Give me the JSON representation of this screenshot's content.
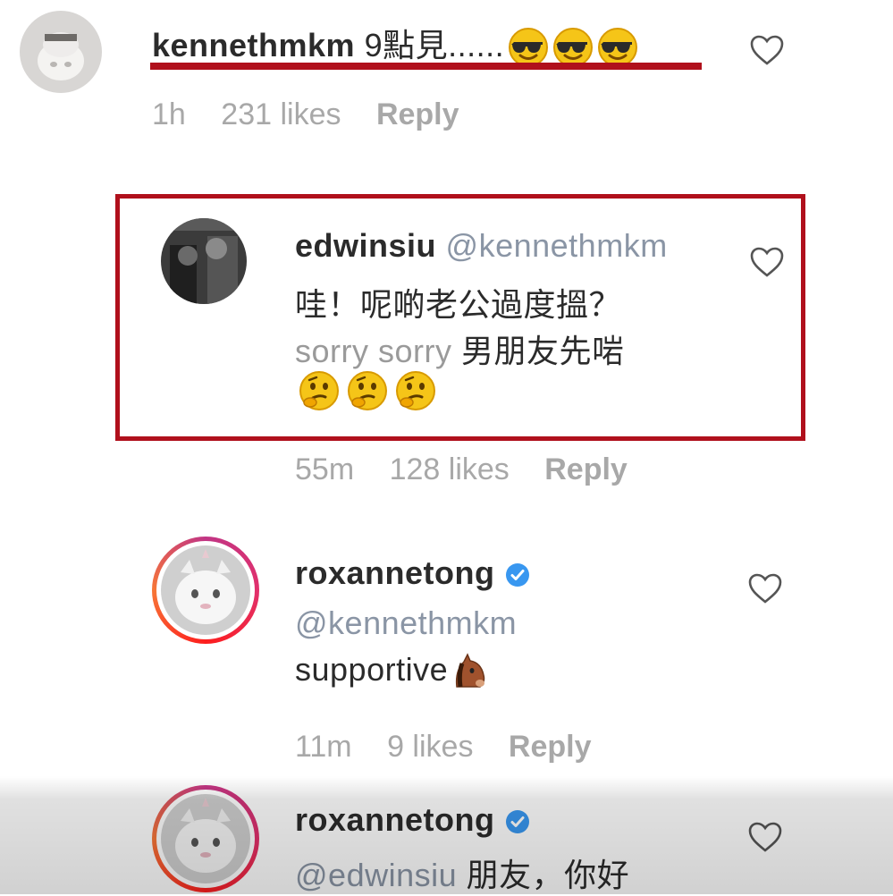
{
  "comments": [
    {
      "username": "kennethmkm",
      "text": "9點見......",
      "emoji_icon": "smiling-face-with-sunglasses",
      "emoji_count": 3,
      "time": "1h",
      "likes": "231 likes",
      "reply": "Reply"
    },
    {
      "username": "edwinsiu",
      "mention": "@kennethmkm",
      "line1": "哇！呢啲老公過度搵？",
      "line2_prefix": "sorry sorry",
      "line2_suffix": "男朋友先啱",
      "emoji_icon": "thinking-face",
      "emoji_count": 3,
      "time": "55m",
      "likes": "128 likes",
      "reply": "Reply"
    },
    {
      "username": "roxannetong",
      "verified": true,
      "mention": "@kennethmkm",
      "text": "supportive",
      "emoji_icon": "horse-face",
      "time": "11m",
      "likes": "9 likes",
      "reply": "Reply"
    },
    {
      "username": "roxannetong",
      "verified": true,
      "mention": "@edwinsiu",
      "text": "朋友，你好"
    }
  ],
  "colors": {
    "highlight": "#b0101c",
    "verified": "#3897f0",
    "mention": "#8a95a5"
  }
}
